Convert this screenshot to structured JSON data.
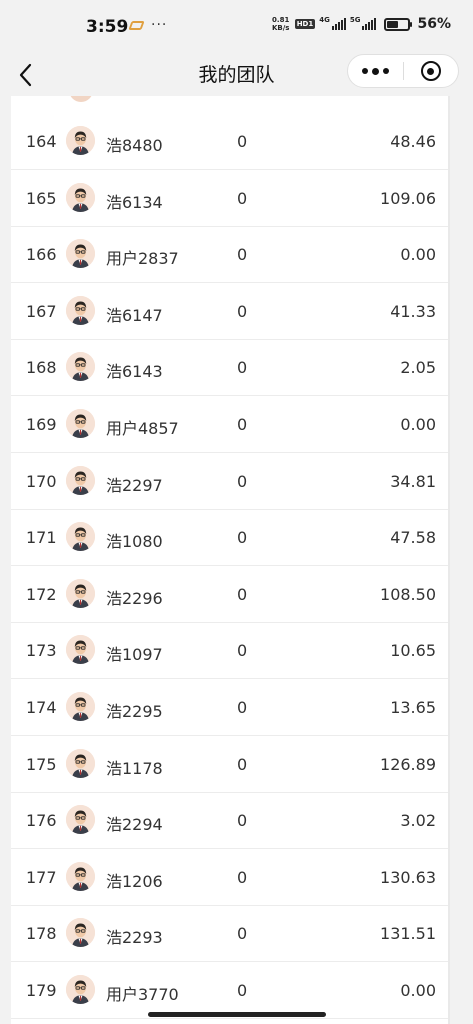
{
  "status": {
    "time": "3:59",
    "ellipsis": "···",
    "net_speed_value": "0.81",
    "net_speed_unit": "KB/s",
    "hd_badge": "HD1",
    "sim1_label": "4G",
    "sim2_label": "5G",
    "battery_level": 0.56,
    "battery_text": "56%"
  },
  "nav": {
    "title": "我的团队"
  },
  "rows": [
    {
      "rank": "164",
      "name": "浩8480",
      "count": "0",
      "amount": "48.46"
    },
    {
      "rank": "165",
      "name": "浩6134",
      "count": "0",
      "amount": "109.06"
    },
    {
      "rank": "166",
      "name": "用户2837",
      "count": "0",
      "amount": "0.00"
    },
    {
      "rank": "167",
      "name": "浩6147",
      "count": "0",
      "amount": "41.33"
    },
    {
      "rank": "168",
      "name": "浩6143",
      "count": "0",
      "amount": "2.05"
    },
    {
      "rank": "169",
      "name": "用户4857",
      "count": "0",
      "amount": "0.00"
    },
    {
      "rank": "170",
      "name": "浩2297",
      "count": "0",
      "amount": "34.81"
    },
    {
      "rank": "171",
      "name": "浩1080",
      "count": "0",
      "amount": "47.58"
    },
    {
      "rank": "172",
      "name": "浩2296",
      "count": "0",
      "amount": "108.50"
    },
    {
      "rank": "173",
      "name": "浩1097",
      "count": "0",
      "amount": "10.65"
    },
    {
      "rank": "174",
      "name": "浩2295",
      "count": "0",
      "amount": "13.65"
    },
    {
      "rank": "175",
      "name": "浩1178",
      "count": "0",
      "amount": "126.89"
    },
    {
      "rank": "176",
      "name": "浩2294",
      "count": "0",
      "amount": "3.02"
    },
    {
      "rank": "177",
      "name": "浩1206",
      "count": "0",
      "amount": "130.63"
    },
    {
      "rank": "178",
      "name": "浩2293",
      "count": "0",
      "amount": "131.51"
    },
    {
      "rank": "179",
      "name": "用户3770",
      "count": "0",
      "amount": "0.00"
    }
  ]
}
